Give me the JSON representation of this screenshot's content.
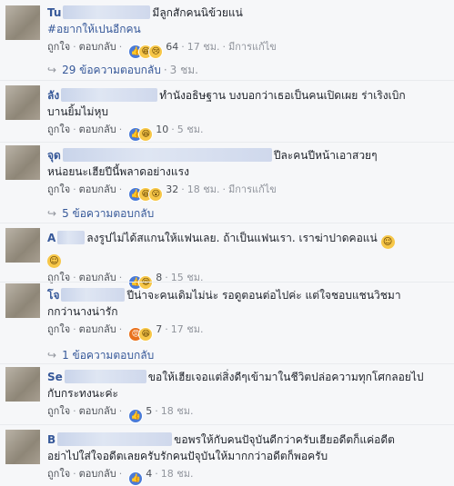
{
  "labels": {
    "like": "ถูกใจ",
    "reply": "ตอบกลับ",
    "edited": "มีการแก้ไข"
  },
  "comments": [
    {
      "name": "Tu",
      "text": "มีลูกสักคนนิข้วยแน่",
      "hashtag": "#อยากให้เปนอีกคน",
      "reaction_count": "64",
      "time": "17 ชม.",
      "replies": "29 ข้อความตอบกลับ",
      "replies_time": "3 ชม."
    },
    {
      "name": "ลัง",
      "text": "ทำนังอธิษฐาน บงบอกว่าเธอเป็นคนเปิดเผย ร่าเริงเบิก",
      "text2": "บานยิ้มไม่หุบ",
      "reaction_count": "10",
      "time": "5 ชม."
    },
    {
      "name": "จุด",
      "text": "ปีละคนปีหน้าเอาสวยๆ",
      "text2": "หน่อยนะเฮียปีนี้พลาดอย่างแรง",
      "reaction_count": "32",
      "time": "18 ชม.",
      "replies": "5 ข้อความตอบกลับ"
    },
    {
      "name": "A",
      "text": "ลงรูปไม่ได้สแกนให้แฟนเลย. ถ้าเป็นแฟนเรา. เราฆ่าปาดคอแน่",
      "reaction_count": "8",
      "time": "15 ชม."
    },
    {
      "name": "โจ",
      "text": "ปีน่าจะคนเดิมไม่น่ะ รอดูตอนต่อไปค่ะ แต่ใจชอบแชนวิชมา",
      "text2": "กกว่านางน่ารัก",
      "reaction_count": "7",
      "time": "17 ชม.",
      "replies": "1 ข้อความตอบกลับ"
    },
    {
      "name": "Se",
      "text": "ขอให้เฮียเจอแต่สิ่งดีๆเข้ามาในชีวิตปล่อความทุกโศกลอยไป",
      "text2": "กับกระทงนะค่ะ",
      "reaction_count": "5",
      "time": "18 ชม."
    },
    {
      "name": "B",
      "text": "ขอพรให้กับคนปัจุบันดีกว่าครับเฮียอดีตก็แค่อดีต",
      "text2": "อย่าไปใส่ใจอดีตเลยครับรักคนปัจุบันให้มากกว่าอดีตก็พอครับ",
      "reaction_count": "4",
      "time": "18 ชม."
    }
  ]
}
